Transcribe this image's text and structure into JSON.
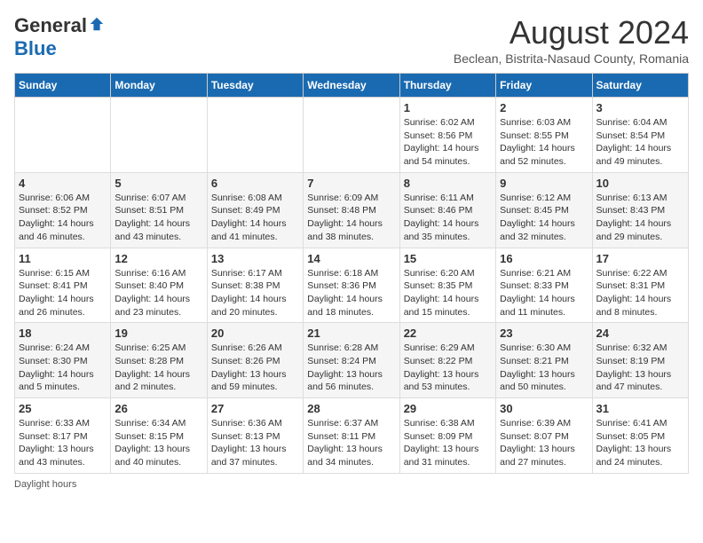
{
  "header": {
    "logo_general": "General",
    "logo_blue": "Blue",
    "month_year": "August 2024",
    "subtitle": "Beclean, Bistrita-Nasaud County, Romania"
  },
  "days_of_week": [
    "Sunday",
    "Monday",
    "Tuesday",
    "Wednesday",
    "Thursday",
    "Friday",
    "Saturday"
  ],
  "weeks": [
    [
      {
        "day": "",
        "info": ""
      },
      {
        "day": "",
        "info": ""
      },
      {
        "day": "",
        "info": ""
      },
      {
        "day": "",
        "info": ""
      },
      {
        "day": "1",
        "info": "Sunrise: 6:02 AM\nSunset: 8:56 PM\nDaylight: 14 hours and 54 minutes."
      },
      {
        "day": "2",
        "info": "Sunrise: 6:03 AM\nSunset: 8:55 PM\nDaylight: 14 hours and 52 minutes."
      },
      {
        "day": "3",
        "info": "Sunrise: 6:04 AM\nSunset: 8:54 PM\nDaylight: 14 hours and 49 minutes."
      }
    ],
    [
      {
        "day": "4",
        "info": "Sunrise: 6:06 AM\nSunset: 8:52 PM\nDaylight: 14 hours and 46 minutes."
      },
      {
        "day": "5",
        "info": "Sunrise: 6:07 AM\nSunset: 8:51 PM\nDaylight: 14 hours and 43 minutes."
      },
      {
        "day": "6",
        "info": "Sunrise: 6:08 AM\nSunset: 8:49 PM\nDaylight: 14 hours and 41 minutes."
      },
      {
        "day": "7",
        "info": "Sunrise: 6:09 AM\nSunset: 8:48 PM\nDaylight: 14 hours and 38 minutes."
      },
      {
        "day": "8",
        "info": "Sunrise: 6:11 AM\nSunset: 8:46 PM\nDaylight: 14 hours and 35 minutes."
      },
      {
        "day": "9",
        "info": "Sunrise: 6:12 AM\nSunset: 8:45 PM\nDaylight: 14 hours and 32 minutes."
      },
      {
        "day": "10",
        "info": "Sunrise: 6:13 AM\nSunset: 8:43 PM\nDaylight: 14 hours and 29 minutes."
      }
    ],
    [
      {
        "day": "11",
        "info": "Sunrise: 6:15 AM\nSunset: 8:41 PM\nDaylight: 14 hours and 26 minutes."
      },
      {
        "day": "12",
        "info": "Sunrise: 6:16 AM\nSunset: 8:40 PM\nDaylight: 14 hours and 23 minutes."
      },
      {
        "day": "13",
        "info": "Sunrise: 6:17 AM\nSunset: 8:38 PM\nDaylight: 14 hours and 20 minutes."
      },
      {
        "day": "14",
        "info": "Sunrise: 6:18 AM\nSunset: 8:36 PM\nDaylight: 14 hours and 18 minutes."
      },
      {
        "day": "15",
        "info": "Sunrise: 6:20 AM\nSunset: 8:35 PM\nDaylight: 14 hours and 15 minutes."
      },
      {
        "day": "16",
        "info": "Sunrise: 6:21 AM\nSunset: 8:33 PM\nDaylight: 14 hours and 11 minutes."
      },
      {
        "day": "17",
        "info": "Sunrise: 6:22 AM\nSunset: 8:31 PM\nDaylight: 14 hours and 8 minutes."
      }
    ],
    [
      {
        "day": "18",
        "info": "Sunrise: 6:24 AM\nSunset: 8:30 PM\nDaylight: 14 hours and 5 minutes."
      },
      {
        "day": "19",
        "info": "Sunrise: 6:25 AM\nSunset: 8:28 PM\nDaylight: 14 hours and 2 minutes."
      },
      {
        "day": "20",
        "info": "Sunrise: 6:26 AM\nSunset: 8:26 PM\nDaylight: 13 hours and 59 minutes."
      },
      {
        "day": "21",
        "info": "Sunrise: 6:28 AM\nSunset: 8:24 PM\nDaylight: 13 hours and 56 minutes."
      },
      {
        "day": "22",
        "info": "Sunrise: 6:29 AM\nSunset: 8:22 PM\nDaylight: 13 hours and 53 minutes."
      },
      {
        "day": "23",
        "info": "Sunrise: 6:30 AM\nSunset: 8:21 PM\nDaylight: 13 hours and 50 minutes."
      },
      {
        "day": "24",
        "info": "Sunrise: 6:32 AM\nSunset: 8:19 PM\nDaylight: 13 hours and 47 minutes."
      }
    ],
    [
      {
        "day": "25",
        "info": "Sunrise: 6:33 AM\nSunset: 8:17 PM\nDaylight: 13 hours and 43 minutes."
      },
      {
        "day": "26",
        "info": "Sunrise: 6:34 AM\nSunset: 8:15 PM\nDaylight: 13 hours and 40 minutes."
      },
      {
        "day": "27",
        "info": "Sunrise: 6:36 AM\nSunset: 8:13 PM\nDaylight: 13 hours and 37 minutes."
      },
      {
        "day": "28",
        "info": "Sunrise: 6:37 AM\nSunset: 8:11 PM\nDaylight: 13 hours and 34 minutes."
      },
      {
        "day": "29",
        "info": "Sunrise: 6:38 AM\nSunset: 8:09 PM\nDaylight: 13 hours and 31 minutes."
      },
      {
        "day": "30",
        "info": "Sunrise: 6:39 AM\nSunset: 8:07 PM\nDaylight: 13 hours and 27 minutes."
      },
      {
        "day": "31",
        "info": "Sunrise: 6:41 AM\nSunset: 8:05 PM\nDaylight: 13 hours and 24 minutes."
      }
    ]
  ],
  "footer": "Daylight hours"
}
